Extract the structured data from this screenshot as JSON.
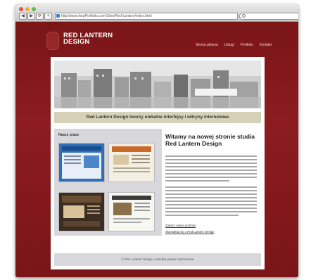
{
  "browser": {
    "url": "http://www.ikepPortfolio.com/Sites/Red-Lantern/index.html",
    "search_placeholder": "",
    "back_icon": "◀",
    "forward_icon": "▶",
    "reload_icon": "⟳",
    "add_icon": "+"
  },
  "site": {
    "logo_line1": "RED LANTERN",
    "logo_line2": "DESIGN",
    "menu": [
      "Strona główna",
      "Usługi",
      "Portfolio",
      "Kontakt"
    ],
    "tagline": "Red Lantern Design tworzy unikalne interfejsy i witryny internetowe",
    "portfolio_title": "Nasze prace",
    "welcome_title": "Witamy na nowej stronie studia Red Lantern Design",
    "link1": "Zobacz nasze portfolio",
    "link2": "Skontaktuj się z Red Lantern Design",
    "footer": "© Red Lantern Design, wszelkie prawa zastrzeżone"
  },
  "colors": {
    "background": "#7a1518",
    "tagline_band": "#d6d2b7",
    "panel": "#d8d8dc"
  }
}
